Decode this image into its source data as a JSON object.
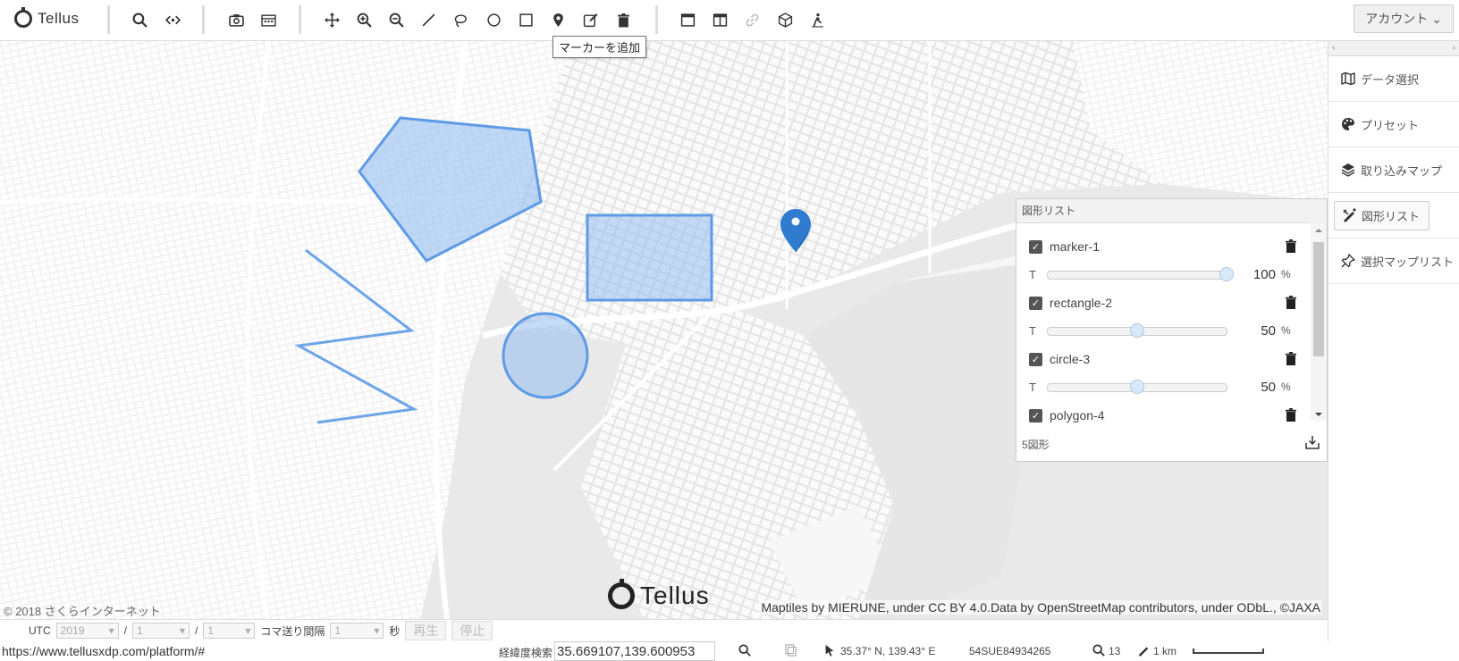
{
  "app": {
    "logo_text": "Tellus"
  },
  "toolbar": {
    "tooltip": "マーカーを追加",
    "account_label": "アカウント",
    "account_caret": "⌄"
  },
  "map": {
    "logo_text": "Tellus",
    "copyright": "© 2018 さくらインターネット",
    "attribution": "Maptiles by MIERUNE, under CC BY 4.0.Data by OpenStreetMap contributors, under ODbL., ©JAXA"
  },
  "shape_list": {
    "title": "図形リスト",
    "items": [
      {
        "name": "marker-1",
        "transparency_label": "T",
        "transparency": 100,
        "unit": "%"
      },
      {
        "name": "rectangle-2",
        "transparency_label": "T",
        "transparency": 50,
        "unit": "%"
      },
      {
        "name": "circle-3",
        "transparency_label": "T",
        "transparency": 50,
        "unit": "%"
      },
      {
        "name": "polygon-4"
      }
    ],
    "count_text": "5図形"
  },
  "sidebar": {
    "collapse_left": "‹",
    "collapse_right": "›",
    "items": [
      {
        "label": "データ選択",
        "icon": "map-icon"
      },
      {
        "label": "プリセット",
        "icon": "palette-icon"
      },
      {
        "label": "取り込みマップ",
        "icon": "layers-icon"
      },
      {
        "label": "図形リスト",
        "icon": "draw-tools-icon"
      },
      {
        "label": "選択マップリスト",
        "icon": "pin-icon"
      }
    ]
  },
  "timebar": {
    "utc_label": "UTC",
    "year": "2019",
    "slash1": "/",
    "month": "1",
    "slash2": "/",
    "day": "1",
    "interval_label": "コマ送り間隔",
    "interval": "1",
    "seconds_label": "秒",
    "play_label": "再生",
    "stop_label": "停止"
  },
  "statusbar": {
    "url": "https://www.tellusxdp.com/platform/#",
    "coord_search_label": "経緯度検索",
    "coord_value": "35.669107,139.600953",
    "cursor_coords": "35.37° N, 139.43° E",
    "mgrs": "54SUE84934265",
    "zoom": "13",
    "scale": "1 km"
  },
  "colors": {
    "shape_fill": "#8db8f0",
    "shape_stroke": "#5e9be6",
    "marker": "#2f7bd0"
  }
}
